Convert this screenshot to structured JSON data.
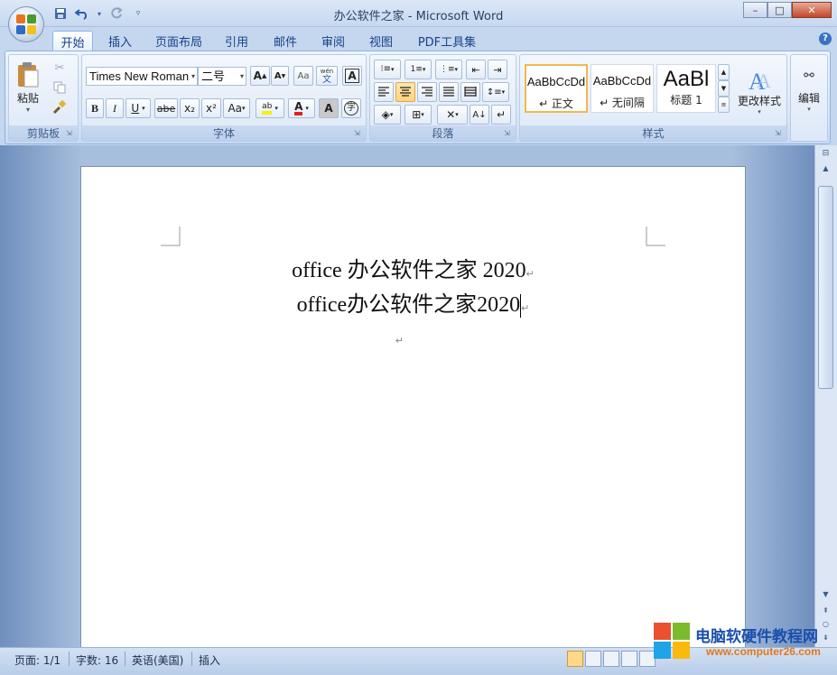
{
  "window": {
    "title": "办公软件之家 - Microsoft Word",
    "controls": {
      "minimize": "–",
      "maximize": "□",
      "close": "✕"
    }
  },
  "quick_access": {
    "save_icon": "save-icon",
    "undo_icon": "undo-icon",
    "redo_icon": "redo-icon",
    "customize_icon": "customize-icon"
  },
  "tabs": [
    {
      "label": "开始",
      "active": true
    },
    {
      "label": "插入"
    },
    {
      "label": "页面布局"
    },
    {
      "label": "引用"
    },
    {
      "label": "邮件"
    },
    {
      "label": "审阅"
    },
    {
      "label": "视图"
    },
    {
      "label": "PDF工具集"
    }
  ],
  "help": "?",
  "ribbon": {
    "clipboard": {
      "label": "剪贴板",
      "paste_label": "粘贴"
    },
    "font": {
      "label": "字体",
      "font_name": "Times New Roman",
      "font_size": "二号",
      "bold": "B",
      "italic": "I",
      "underline": "U",
      "strike": "abe",
      "subscript": "x₂",
      "superscript": "x²",
      "change_case": "Aa",
      "grow": "A",
      "shrink": "A",
      "clear_format": "A",
      "char_border": "A",
      "enclose": "字",
      "phonetic": "wén",
      "phonetic_char": "文"
    },
    "paragraph": {
      "label": "段落"
    },
    "styles": {
      "label": "样式",
      "items": [
        {
          "sample": "AaBbCcDd",
          "name": "↵ 正文",
          "selected": true
        },
        {
          "sample": "AaBbCcDd",
          "name": "↵ 无间隔"
        },
        {
          "sample": "AaBl",
          "name": "标题 1"
        }
      ],
      "change_styles": "更改样式"
    },
    "editing": {
      "label": "编辑"
    }
  },
  "document": {
    "lines": [
      "office 办公软件之家 2020",
      "office办公软件之家2020"
    ],
    "paragraph_mark": "↵"
  },
  "statusbar": {
    "page": "页面: 1/1",
    "words": "字数: 16",
    "language": "英语(美国)",
    "mode": "插入"
  },
  "watermark": {
    "text": "电脑软硬件教程网",
    "url": "www.computer26.com"
  },
  "colors": {
    "accent": "#15428b",
    "selected_button": "#ffd37a",
    "font_color_bar": "#e02020",
    "highlight_bar": "#f6f000"
  }
}
